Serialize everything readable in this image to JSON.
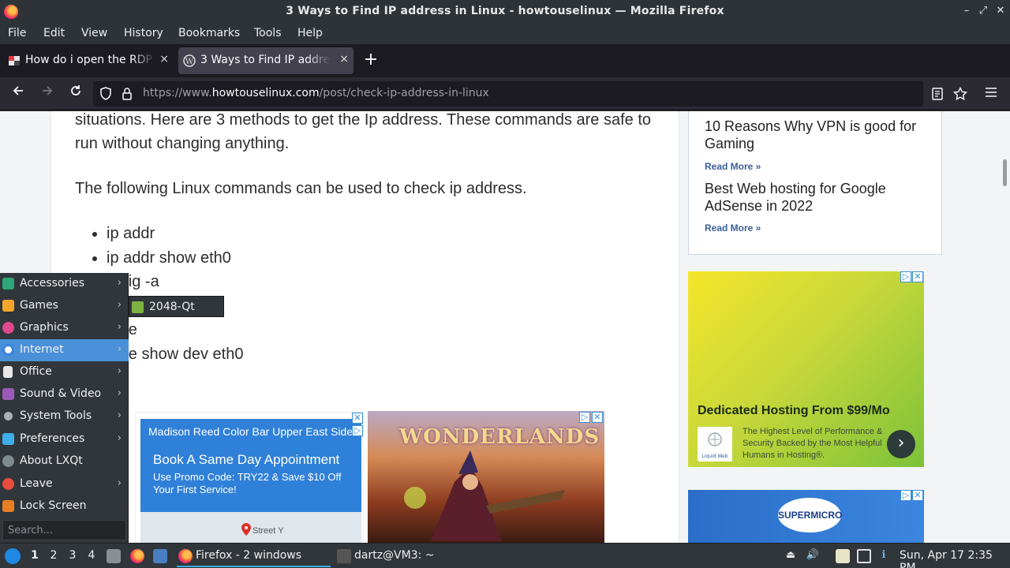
{
  "window": {
    "title": "3 Ways to Find IP address in Linux - howtouselinux — Mozilla Firefox",
    "controls": {
      "minimize": "–",
      "maximize": "⤢",
      "close": "✕"
    }
  },
  "menubar": [
    "File",
    "Edit",
    "View",
    "History",
    "Bookmarks",
    "Tools",
    "Help"
  ],
  "tabs": [
    {
      "label": "How do i open the RDP p",
      "active": false
    },
    {
      "label": "3 Ways to Find IP address",
      "active": true
    }
  ],
  "tab_close": "×",
  "new_tab": "+",
  "nav": {
    "url_prefix": "https://www.",
    "url_host": "howtouselinux.com",
    "url_path": "/post/check-ip-address-in-linux"
  },
  "article": {
    "p1": "situations. Here are 3 methods to get the Ip address. These commands are safe to run without changing anything.",
    "p2": "The following Linux commands can be used to check ip address.",
    "commands": [
      "ip addr",
      "ip addr show eth0",
      "onfig -a",
      "",
      "oute",
      "oute show dev eth0"
    ]
  },
  "ad_madison": {
    "small": "Madison Reed Color Bar Upper East Side",
    "headline": "Book A Same Day Appointment",
    "sub": "Use Promo Code: TRY22 & Save $10 Off Your First Service!",
    "street": "Street Y"
  },
  "ad_wonderlands": {
    "title": "WONDERLANDS"
  },
  "sidebar": {
    "posts": [
      {
        "title": "10 Reasons Why VPN is good for Gaming",
        "more": "Read More »"
      },
      {
        "title": "Best Web hosting for Google AdSense in 2022",
        "more": "Read More »"
      }
    ]
  },
  "ad_hosting": {
    "headline": "Dedicated Hosting From $99/Mo",
    "logo": "Liquid Web",
    "text": "The Highest Level of Performance & Security Backed by the Most Helpful Humans in Hosting®.",
    "arrow": "›"
  },
  "ad_supermicro": {
    "logo": "SUPERMICRO"
  },
  "appmenu": {
    "items": [
      {
        "label": "Accessories",
        "submenu": true,
        "icon": "accessories-icon",
        "color": "#2ea879"
      },
      {
        "label": "Games",
        "submenu": true,
        "icon": "games-icon",
        "color": "#f4a62a"
      },
      {
        "label": "Graphics",
        "submenu": true,
        "icon": "graphics-icon",
        "color": "#e04a8a"
      },
      {
        "label": "Internet",
        "submenu": true,
        "icon": "internet-icon",
        "color": "#3b82e0",
        "highlighted": true
      },
      {
        "label": "Office",
        "submenu": true,
        "icon": "office-icon",
        "color": "#e8e8e8"
      },
      {
        "label": "Sound & Video",
        "submenu": true,
        "icon": "sound-video-icon",
        "color": "#9b59b6"
      },
      {
        "label": "System Tools",
        "submenu": true,
        "icon": "system-tools-icon",
        "color": "#aab0b6"
      },
      {
        "label": "Preferences",
        "submenu": true,
        "icon": "preferences-icon",
        "color": "#3daee9"
      },
      {
        "label": "About LXQt",
        "submenu": false,
        "icon": "about-icon",
        "color": "#7f8c8d"
      },
      {
        "label": "Leave",
        "submenu": true,
        "icon": "leave-icon",
        "color": "#e74c3c"
      },
      {
        "label": "Lock Screen",
        "submenu": false,
        "icon": "lock-icon",
        "color": "#e67e22"
      }
    ],
    "search_placeholder": "Search...",
    "submenu_item": "2048-Qt"
  },
  "taskbar": {
    "desktops": [
      "1",
      "2",
      "3",
      "4"
    ],
    "tasks": [
      {
        "label": "Firefox - 2 windows",
        "active": true
      },
      {
        "label": "dartz@VM3: ~",
        "active": false
      }
    ],
    "clock": "Sun, Apr 17  2:35 PM"
  }
}
